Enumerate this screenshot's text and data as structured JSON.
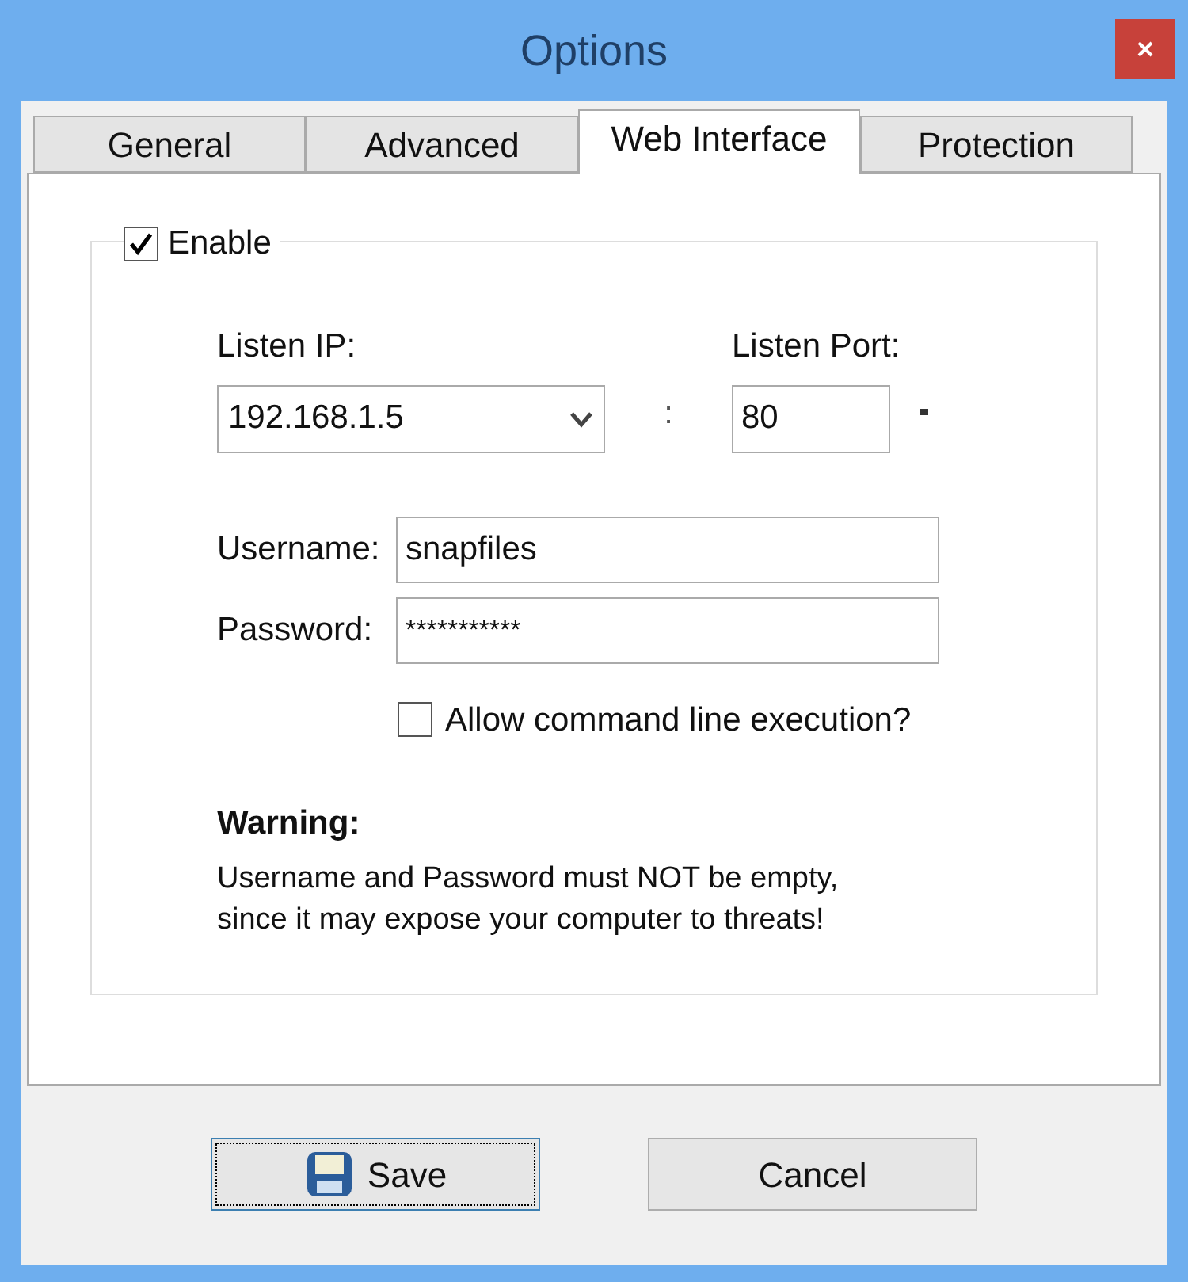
{
  "window": {
    "title": "Options"
  },
  "tabs": [
    {
      "label": "General",
      "selected": false
    },
    {
      "label": "Advanced",
      "selected": false
    },
    {
      "label": "Web Interface",
      "selected": true
    },
    {
      "label": "Protection",
      "selected": false
    }
  ],
  "enable": {
    "label": "Enable",
    "checked": true
  },
  "listen_ip": {
    "label": "Listen IP:",
    "value": "192.168.1.5"
  },
  "separator": ":",
  "listen_port": {
    "label": "Listen Port:",
    "value": "80"
  },
  "username": {
    "label": "Username:",
    "value": "snapfiles"
  },
  "password": {
    "label": "Password:",
    "value": "***********"
  },
  "allow_cmd": {
    "label": "Allow command line execution?",
    "checked": false
  },
  "warning": {
    "title": "Warning:",
    "text": "Username and Password must NOT be empty,\nsince it may expose your computer to threats!"
  },
  "buttons": [
    {
      "label": "Save",
      "kind": "save",
      "focused": true
    },
    {
      "label": "Cancel",
      "kind": "cancel",
      "focused": false
    }
  ]
}
